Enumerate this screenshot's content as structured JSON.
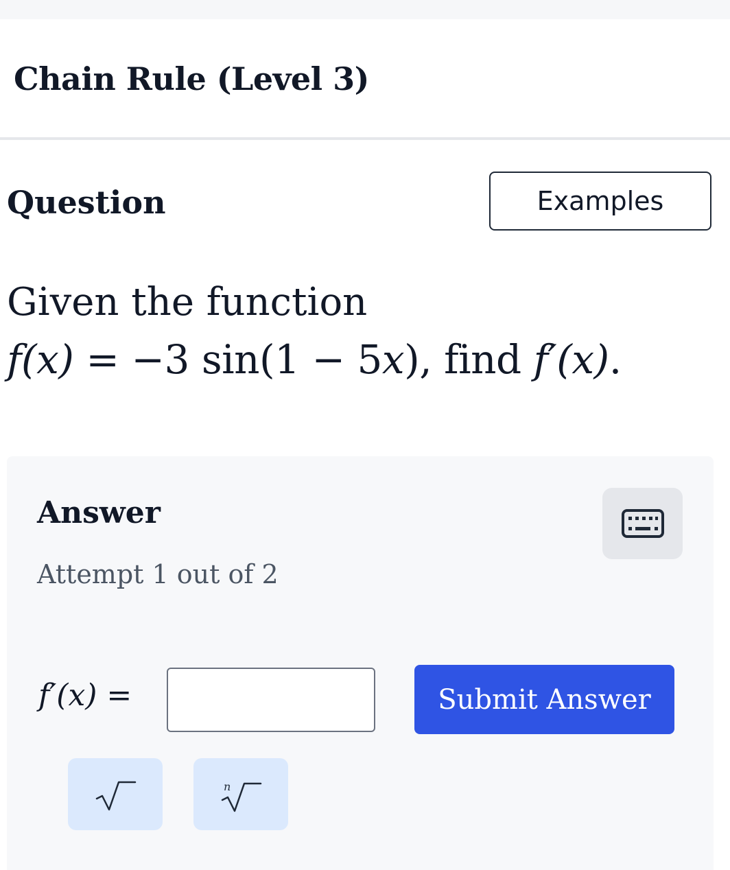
{
  "header": {
    "title": "Chain Rule (Level 3)"
  },
  "question": {
    "heading": "Question",
    "examples_label": "Examples",
    "prompt_line1": "Given the function",
    "prompt_fx": "f(x)",
    "prompt_eq": " = −3 sin(1 − 5",
    "prompt_x": "x",
    "prompt_tail": "), find ",
    "prompt_fpx": "f′(x)",
    "prompt_end": "."
  },
  "answer": {
    "heading": "Answer",
    "attempt_text": "Attempt 1 out of 2",
    "label_fpx": "f′(x)",
    "label_eq": " =",
    "input_value": "",
    "submit_label": "Submit Answer"
  },
  "math_keys": {
    "sqrt_icon": "square-root-icon",
    "nroot_icon": "nth-root-icon",
    "nroot_index": "n"
  },
  "colors": {
    "accent": "#2f54e4",
    "panel_bg": "#f7f8fa",
    "math_key_bg": "#dbe9fd",
    "keyboard_btn_bg": "#e5e7eb"
  }
}
